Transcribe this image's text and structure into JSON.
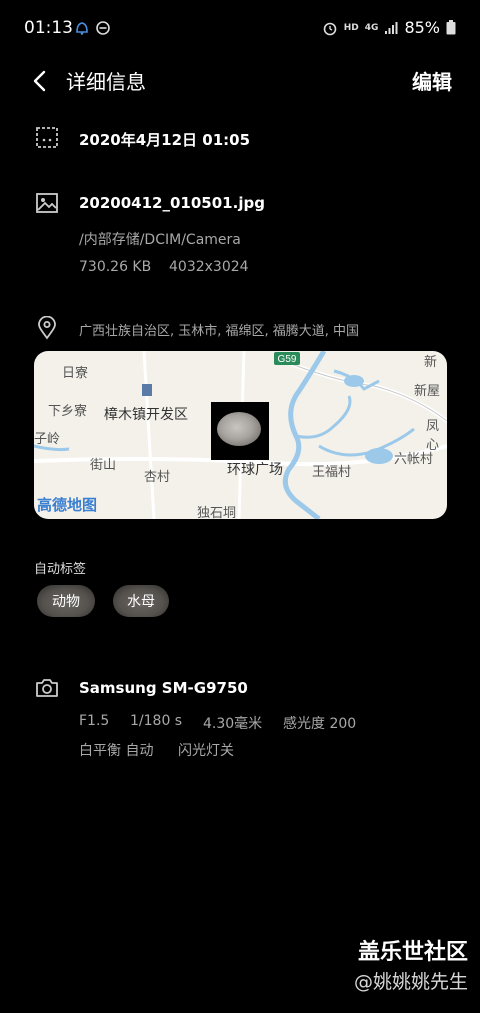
{
  "status_bar": {
    "time": "01:13",
    "hd": "HD",
    "network": "4G",
    "battery": "85%"
  },
  "header": {
    "title": "详细信息",
    "edit_label": "编辑"
  },
  "date_section": {
    "datetime": "2020年4月12日 01:05"
  },
  "file_section": {
    "filename": "20200412_010501.jpg",
    "path": "/内部存储/DCIM/Camera",
    "size": "730.26 KB",
    "resolution": "4032x3024"
  },
  "location_section": {
    "address": "广西壮族自治区, 玉林市, 福绵区, 福腾大道, 中国",
    "map": {
      "road_badge": "G59",
      "place_labels": [
        "日寮",
        "下乡寮",
        "樟木镇开发区",
        "子岭",
        "街山",
        "杏村",
        "独石垌",
        "环球广场",
        "王福村",
        "新屋",
        "六帐村",
        "新",
        "凤心"
      ],
      "logo": "高德地图"
    }
  },
  "tags_section": {
    "label": "自动标签",
    "tags": [
      "动物",
      "水母"
    ]
  },
  "camera_section": {
    "model": "Samsung SM-G9750",
    "aperture": "F1.5",
    "shutter": "1/180 s",
    "focal_length": "4.30毫米",
    "iso": "感光度 200",
    "white_balance": "白平衡 自动",
    "flash": "闪光灯关"
  },
  "watermark": {
    "line1": "盖乐世社区",
    "line2": "@姚姚姚先生"
  },
  "colors": {
    "background": "#000000",
    "map_water": "#9cc9ea",
    "map_badge": "#2a8a5a"
  }
}
